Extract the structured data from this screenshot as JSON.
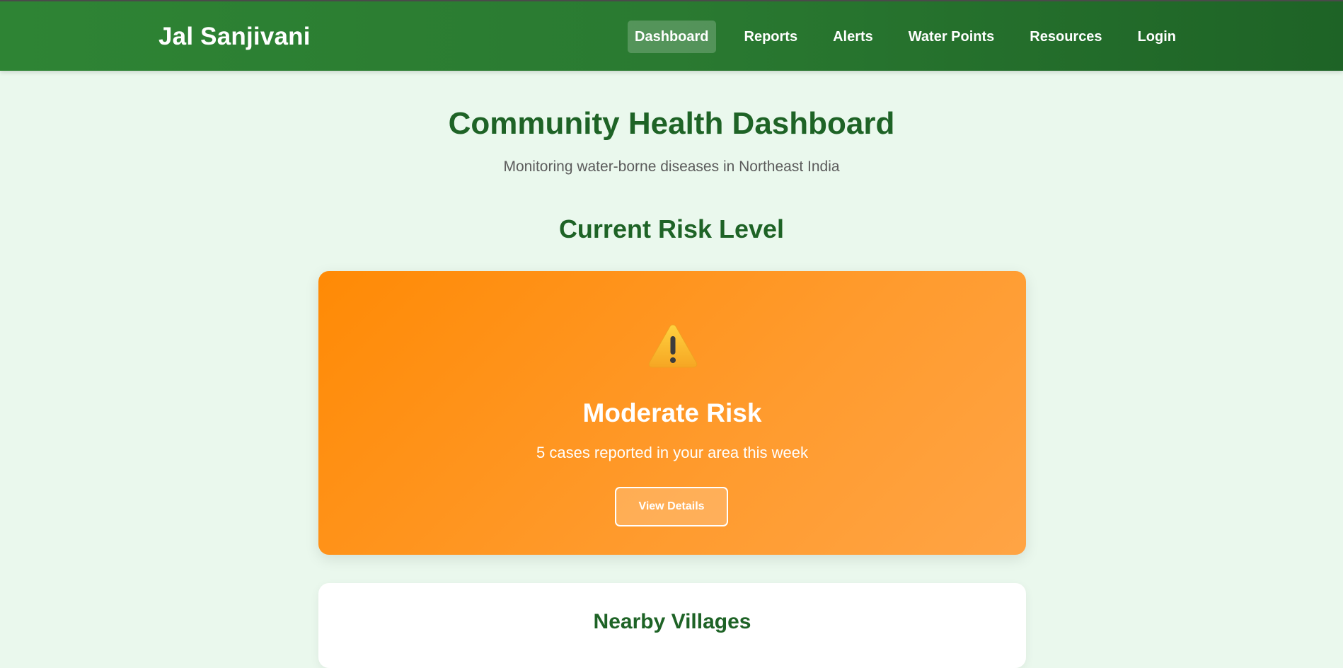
{
  "header": {
    "brand": "Jal Sanjivani",
    "nav": [
      {
        "label": "Dashboard",
        "active": true
      },
      {
        "label": "Reports",
        "active": false
      },
      {
        "label": "Alerts",
        "active": false
      },
      {
        "label": "Water Points",
        "active": false
      },
      {
        "label": "Resources",
        "active": false
      },
      {
        "label": "Login",
        "active": false
      }
    ]
  },
  "main": {
    "title": "Community Health Dashboard",
    "subtitle": "Monitoring water-borne diseases in Northeast India",
    "risk_section_title": "Current Risk Level",
    "risk_card": {
      "icon": "warning-icon",
      "level": "Moderate Risk",
      "description": "5 cases reported in your area this week",
      "button_label": "View Details",
      "color": "#ff8a05"
    },
    "villages_card": {
      "title": "Nearby Villages"
    }
  },
  "colors": {
    "brand_green": "#2e8434",
    "heading_green": "#1e6326",
    "background": "#eaf8ed",
    "risk_orange": "#ff8a05"
  }
}
